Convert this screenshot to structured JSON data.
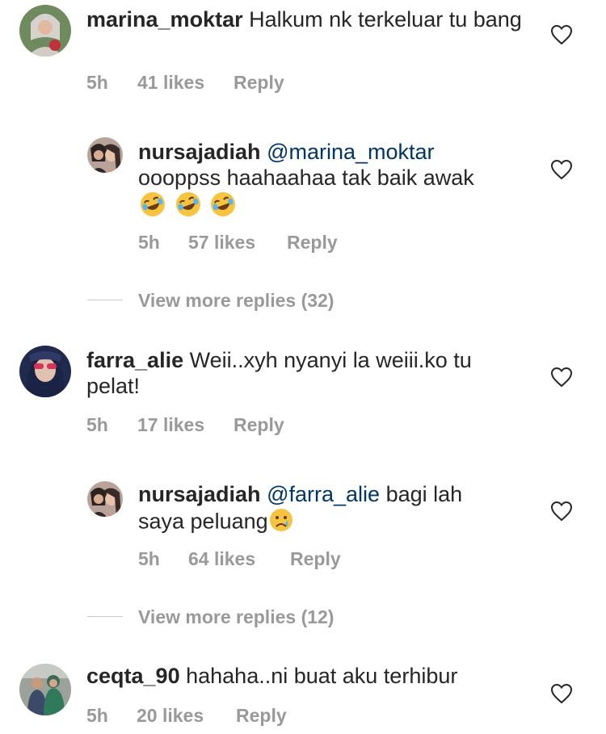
{
  "comments": [
    {
      "username": "marina_moktar",
      "text": "Halkum nk terkeluar tu bang",
      "time": "5h",
      "likes": "41 likes",
      "reply": "Reply",
      "reply_item": {
        "username": "nursajadiah",
        "mention": "@marina_moktar",
        "text": "oooppss haahaahaa tak baik awak",
        "emoji": [
          "rofl",
          "rofl",
          "rofl"
        ],
        "time": "5h",
        "likes": "57 likes",
        "reply": "Reply"
      },
      "view_more": "View more replies (32)"
    },
    {
      "username": "farra_alie",
      "text": "Weii..xyh nyanyi la weiii.ko tu pelat!",
      "time": "5h",
      "likes": "17 likes",
      "reply": "Reply",
      "reply_item": {
        "username": "nursajadiah",
        "mention": "@farra_alie",
        "text": "bagi lah saya peluang",
        "emoji": [
          "crying-face"
        ],
        "time": "5h",
        "likes": "64 likes",
        "reply": "Reply"
      },
      "view_more": "View more replies (12)"
    },
    {
      "username": "ceqta_90",
      "text": "hahaha..ni buat aku terhibur",
      "time": "5h",
      "likes": "20 likes",
      "reply": "Reply"
    }
  ],
  "colors": {
    "text": "#262626",
    "meta": "#999999",
    "mention": "#003569",
    "divider": "#c7c7c7"
  },
  "icons": {
    "like": "heart-outline-icon"
  }
}
